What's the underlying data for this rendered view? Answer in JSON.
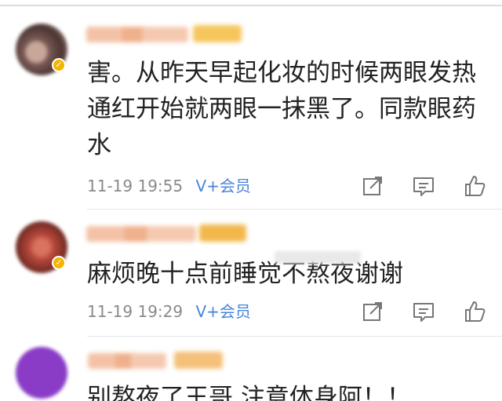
{
  "comments": [
    {
      "text": "害。从昨天早起化妆的时候两眼发热通红开始就两眼一抹黑了。同款眼药水",
      "time": "11-19 19:55",
      "vip_label": "V+会员"
    },
    {
      "text": "麻烦晚十点前睡觉不熬夜谢谢",
      "time": "11-19 19:29",
      "vip_label": "V+会员"
    },
    {
      "text": "别熬夜了王哥 注意体身阿！！"
    }
  ],
  "icons": {
    "share": "share-icon",
    "comment": "comment-icon",
    "like": "like-icon"
  },
  "colors": {
    "vip_blue": "#4a84d8",
    "meta_gray": "#8a8a8a",
    "badge_gold": "#f4b400"
  }
}
